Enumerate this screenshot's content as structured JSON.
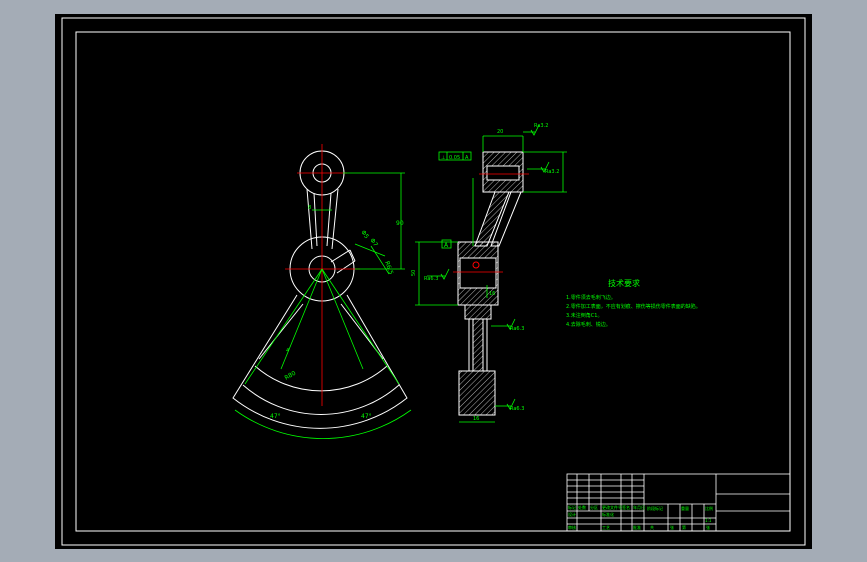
{
  "colors": {
    "background": "#000000",
    "outer_frame": "#a4acb6",
    "geometry": "#ffffff",
    "dimensions": "#00ff00",
    "centerline": "#ff0000",
    "hatch": "#ffffff"
  },
  "front_view": {
    "dim_vertical": "90",
    "dim_diag_1": "Φ5",
    "dim_diag_2": "Φ7",
    "dim_side": "R6.5",
    "dim_small": "8",
    "dim_angle_left": "47°",
    "dim_angle_right": "47°",
    "dim_radius": "R80",
    "dim_inner": "4"
  },
  "side_view": {
    "dim_top_width": "20",
    "tol_frame": [
      "⊥",
      "0.05",
      "A"
    ],
    "ra_top": "Ra3.2",
    "ra_mid": "Ra3.2",
    "ra_left": "Ra6.3",
    "ra_low": "Ra6.3",
    "ra_bottom": "Ra6.3",
    "dim_h": "50",
    "dim_d": "16",
    "dim_low": "16",
    "datum": "A"
  },
  "tech_req": {
    "title": "技术要求",
    "lines": [
      "1.零件须去毛刺飞边。",
      "2.零件加工表面，不应有划痕、擦伤等损伤零件表面的缺陷。",
      "3.未注倒角C1。",
      "4.去除毛刺、锐边。"
    ]
  },
  "title_block": {
    "row_a": [
      "标记",
      "处数",
      "分区",
      "更改文件号",
      "签名",
      "年月日"
    ],
    "row_b": [
      "设计",
      "",
      "标准化",
      ""
    ],
    "row_c": [
      "审核",
      "",
      "工艺",
      "",
      "批准"
    ],
    "stage_labels": [
      "阶段标记",
      "重量",
      "比例"
    ],
    "scale": "1:1",
    "sheet_labels": [
      "共",
      "张",
      "第",
      "张"
    ]
  }
}
